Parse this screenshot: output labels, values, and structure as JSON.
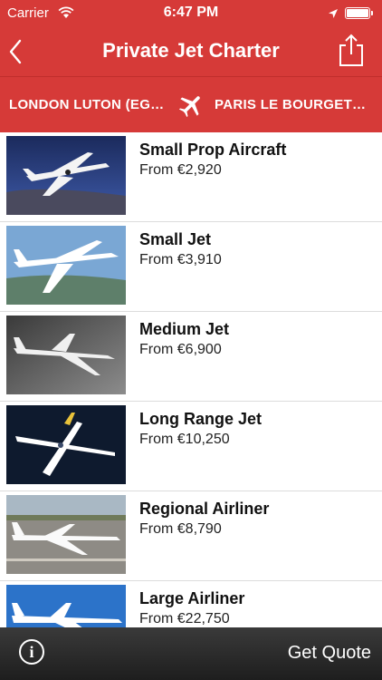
{
  "status_bar": {
    "carrier": "Carrier",
    "time": "6:47 PM"
  },
  "nav": {
    "title": "Private Jet Charter"
  },
  "route": {
    "from": "LONDON LUTON (EG…",
    "to": "PARIS LE BOURGET…"
  },
  "aircraft": [
    {
      "name": "Small Prop Aircraft",
      "price": "From €2,920"
    },
    {
      "name": "Small Jet",
      "price": "From €3,910"
    },
    {
      "name": "Medium Jet",
      "price": "From €6,900"
    },
    {
      "name": "Long Range Jet",
      "price": "From €10,250"
    },
    {
      "name": "Regional Airliner",
      "price": "From €8,790"
    },
    {
      "name": "Large Airliner",
      "price": "From €22,750"
    }
  ],
  "toolbar": {
    "info_label": "i",
    "quote_label": "Get Quote"
  },
  "colors": {
    "brand_red": "#d63a38",
    "toolbar_dark": "#262626"
  }
}
